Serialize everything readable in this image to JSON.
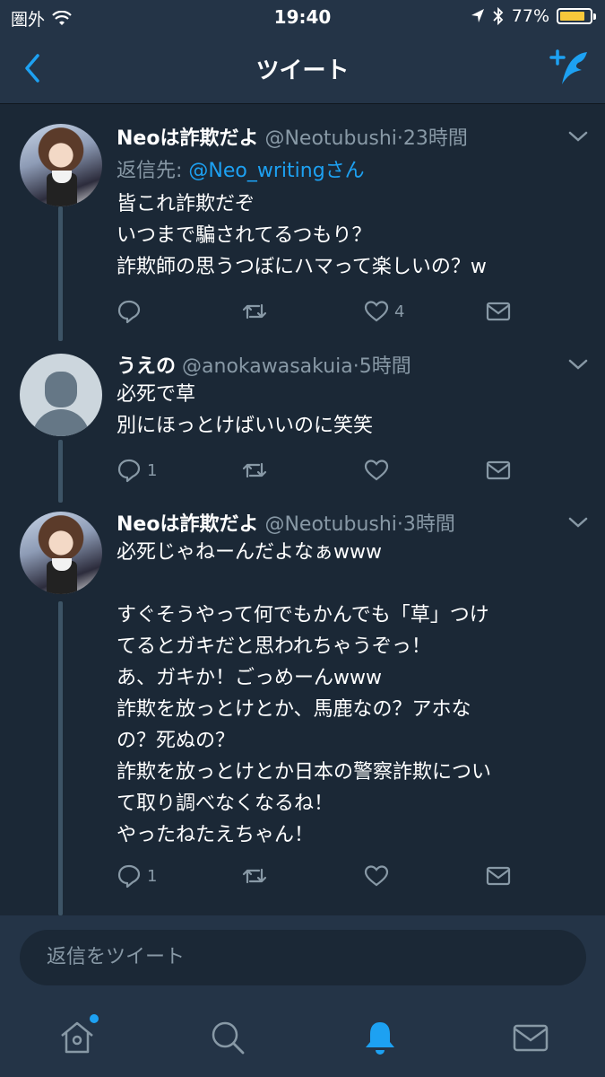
{
  "status_bar": {
    "carrier": "圏外",
    "time": "19:40",
    "battery": "77%",
    "battery_level": 0.77,
    "icons": [
      "wifi-icon",
      "location-icon",
      "bluetooth-icon",
      "battery-icon"
    ]
  },
  "nav": {
    "title": "ツイート",
    "back_icon": "chevron-left-icon",
    "compose_icon": "compose-tweet-icon"
  },
  "colors": {
    "background": "#1b2836",
    "bar": "#243447",
    "accent": "#1da1f2",
    "muted": "#8899a6",
    "battery": "#f7c83b"
  },
  "tweets": [
    {
      "name": "Neoは詐欺だよ",
      "handle": "@Neotubushi",
      "sep": "·",
      "time": "23時間",
      "reply_label": "返信先: ",
      "reply_to": "@Neo_writingさん",
      "body": "皆これ詐欺だぞ\nいつまで騙されてるつもり？\n詐欺師の思うつぼにハマって楽しいの？w",
      "replies": "",
      "retweets": "",
      "likes": "4"
    },
    {
      "name": "うえの",
      "handle": "@anokawasakuia",
      "sep": "·",
      "time": "5時間",
      "body": "必死で草\n別にほっとけばいいのに笑笑",
      "replies": "1",
      "retweets": "",
      "likes": ""
    },
    {
      "name": "Neoは詐欺だよ",
      "handle": "@Neotubushi",
      "sep": "·",
      "time": "3時間",
      "body": "必死じゃねーんだよなぁwww\n\nすぐそうやって何でもかんでも「草」つけ\nてるとガキだと思われちゃうぞっ！\nあ、ガキか！ごっめーんwww\n詐欺を放っとけとか、馬鹿なの？アホな\nの？死ぬの？\n詐欺を放っとけとか日本の警察詐欺につい\nて取り調べなくなるね！\nやったねたえちゃん！",
      "replies": "1",
      "retweets": "",
      "likes": ""
    }
  ],
  "reply_bar": {
    "placeholder": "返信をツイート"
  },
  "tabs": [
    "home-icon",
    "search-icon",
    "notifications-icon",
    "messages-icon"
  ]
}
